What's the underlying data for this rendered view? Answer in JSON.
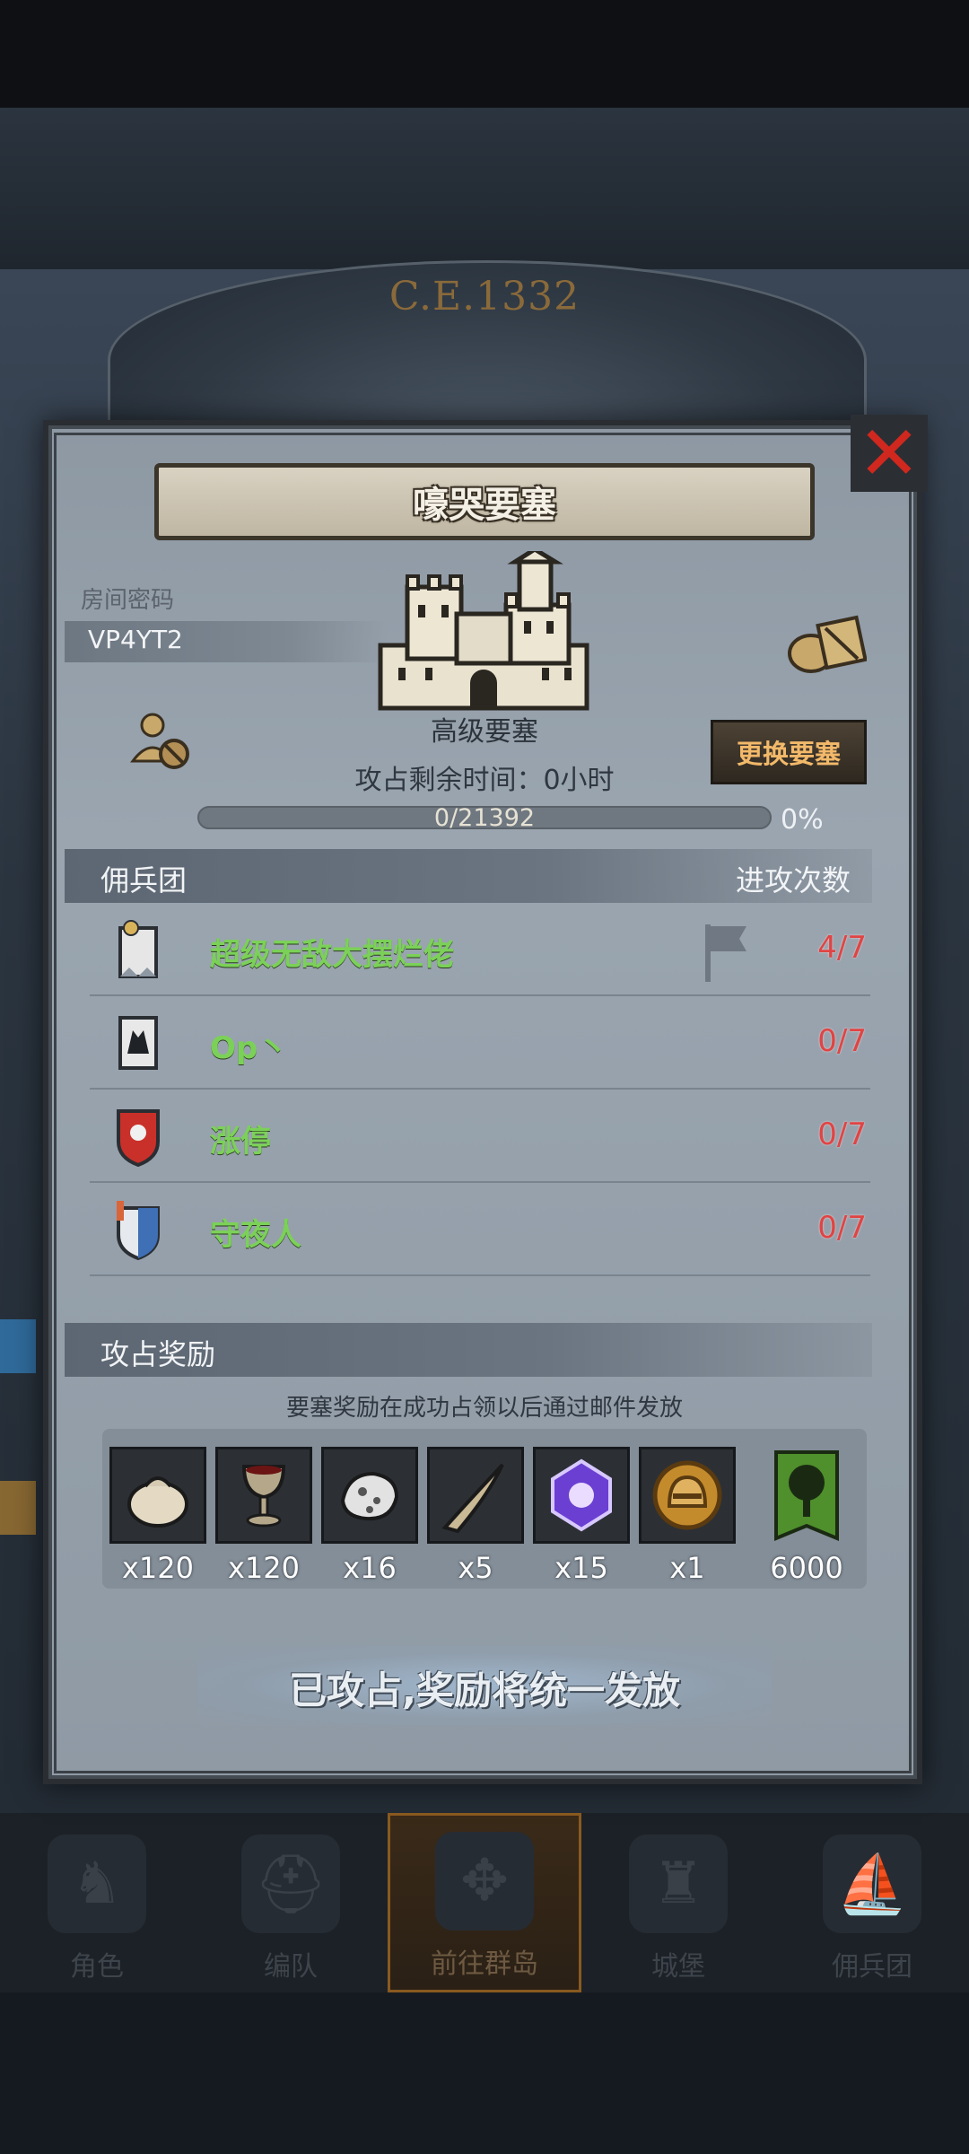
{
  "background": {
    "era": "C.E.1332"
  },
  "bottom_nav": [
    {
      "label": "角色",
      "icon": "knight-icon"
    },
    {
      "label": "编队",
      "icon": "helmet-icon"
    },
    {
      "label": "前往群岛",
      "icon": "compass-icon",
      "active": true
    },
    {
      "label": "城堡",
      "icon": "castle-icon"
    },
    {
      "label": "佣兵团",
      "icon": "ship-icon"
    }
  ],
  "modal": {
    "title": "嚎哭要塞",
    "room_code_label": "房间密码",
    "room_code": "VP4YT2",
    "fortress_level": "高级要塞",
    "change_button": "更换要塞",
    "time_left": "攻占剩余时间：0小时",
    "progress_text": "0/21392",
    "progress_fraction": 0,
    "progress_pct": "0%",
    "legion_header": "佣兵团",
    "attack_count_header": "进攻次数",
    "legions": [
      {
        "name": "超级无敌大摆烂佬",
        "count": "4/7",
        "badge": "white-banner-badge"
      },
      {
        "name": "Op丶",
        "count": "0/7",
        "badge": "wolf-badge"
      },
      {
        "name": "涨停",
        "count": "0/7",
        "badge": "sun-shield-badge"
      },
      {
        "name": "守夜人",
        "count": "0/7",
        "badge": "blue-shield-badge"
      }
    ],
    "reward_header": "攻占奖励",
    "reward_note": "要塞奖励在成功占领以后通过邮件发放",
    "rewards": [
      {
        "icon": "sack-icon",
        "qty": "x120"
      },
      {
        "icon": "goblet-icon",
        "qty": "x120"
      },
      {
        "icon": "ore-icon",
        "qty": "x16"
      },
      {
        "icon": "horn-icon",
        "qty": "x5"
      },
      {
        "icon": "purple-crystal-icon",
        "qty": "x15"
      },
      {
        "icon": "helmet-medal-icon",
        "qty": "x1"
      },
      {
        "icon": "tree-banner-icon",
        "qty": "6000"
      }
    ],
    "claimed_text": "已攻占,奖励将统一发放"
  },
  "colors": {
    "legion_name": "#7bd158",
    "attack_count": "#e04444",
    "close": "#d0281e",
    "change_button_text": "#f2b96a"
  }
}
